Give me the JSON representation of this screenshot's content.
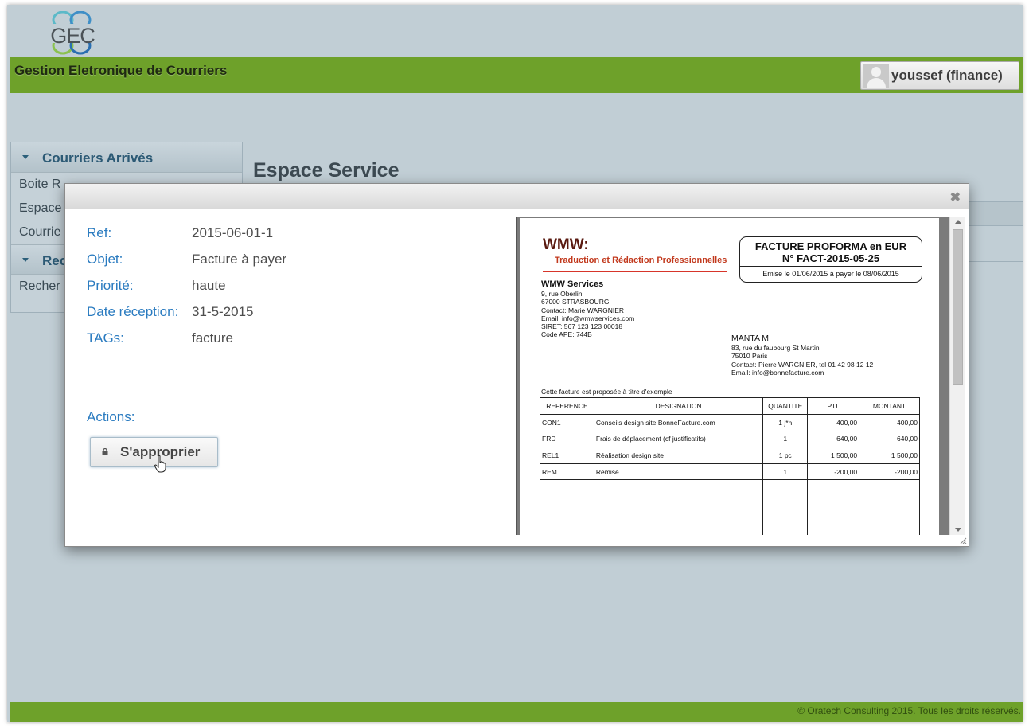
{
  "logo": {
    "text": "GEC"
  },
  "header": {
    "app_title": "Gestion Eletronique de Courriers",
    "user": "youssef (finance)"
  },
  "sidebar": {
    "sections": [
      {
        "label": "Courriers Arrivés",
        "items": [
          "Boite R",
          "Espace",
          "Courrie"
        ]
      },
      {
        "label": "Rec",
        "items": [
          "Recher"
        ]
      }
    ]
  },
  "main": {
    "title": "Espace Service"
  },
  "modal": {
    "fields": [
      {
        "key": "Ref:",
        "value": "2015-06-01-1"
      },
      {
        "key": "Objet:",
        "value": "Facture à payer"
      },
      {
        "key": "Priorité:",
        "value": "haute"
      },
      {
        "key": "Date réception:",
        "value": "31-5-2015"
      },
      {
        "key": "TAGs:",
        "value": "facture"
      }
    ],
    "actions_label": "Actions:",
    "action_button": "S'approprier"
  },
  "document": {
    "company": "WMW:",
    "tagline": "Traduction et Rédaction Professionnelles",
    "invoice_title": "FACTURE PROFORMA en EUR",
    "invoice_number": "N° FACT-2015-05-25",
    "invoice_dates": "Emise le 01/06/2015 à payer le 08/06/2015",
    "sender_name": "WMW Services",
    "sender_lines": [
      "9, rue Oberlin",
      "67000 STRASBOURG",
      "Contact: Marie WARGNIER",
      "Email: info@wmwservices.com",
      "SIRET: 567 123 123 00018",
      "Code APE: 744B"
    ],
    "client_name": "MANTA M",
    "client_lines": [
      "83, rue du faubourg St Martin",
      "75010 Paris",
      "Contact: Pierre WARGNIER, tel 01 42 98 12 12",
      "Email: info@bonnefacture.com"
    ],
    "note": "Cette facture est proposée à titre d'exemple",
    "table_headers": [
      "REFERENCE",
      "DESIGNATION",
      "QUANTITE",
      "P.U.",
      "MONTANT"
    ],
    "table_rows": [
      [
        "CON1",
        "Conseils design site BonneFacture.com",
        "1 j*h",
        "400,00",
        "400,00"
      ],
      [
        "FRD",
        "Frais de déplacement (cf justificatifs)",
        "1",
        "640,00",
        "640,00"
      ],
      [
        "REL1",
        "Réalisation design site",
        "1 pc",
        "1 500,00",
        "1 500,00"
      ],
      [
        "REM",
        "Remise",
        "1",
        "-200,00",
        "-200,00"
      ]
    ]
  },
  "footer": {
    "text": "© Oratech Consulting 2015. Tous les droits réservés."
  },
  "colors": {
    "brand_green": "#6ea12a",
    "background": "#c1ced5",
    "link_blue": "#2a7bc0"
  },
  "icons": [
    "user-avatar-icon",
    "caret-down-icon",
    "close-icon",
    "lock-icon",
    "hand-cursor-icon"
  ]
}
